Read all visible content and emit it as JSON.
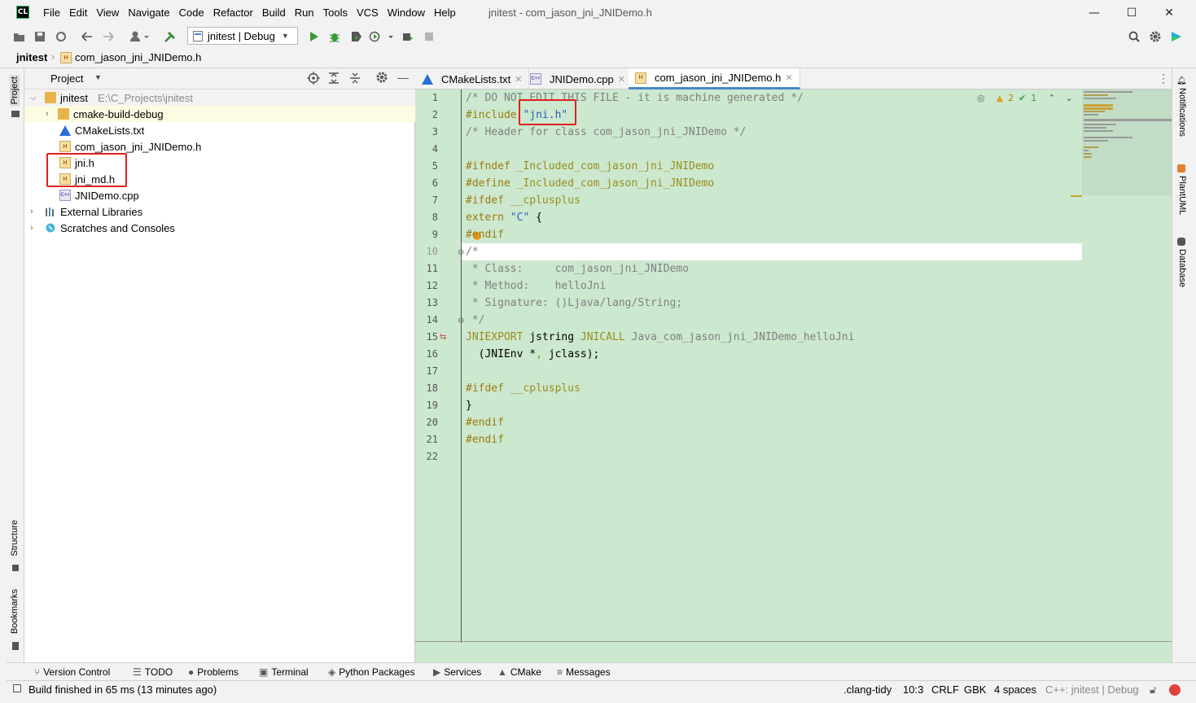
{
  "titlebar": {
    "logo": "CL",
    "menu": [
      "File",
      "Edit",
      "View",
      "Navigate",
      "Code",
      "Refactor",
      "Build",
      "Run",
      "Tools",
      "VCS",
      "Window",
      "Help"
    ],
    "window_title": "jnitest - com_jason_jni_JNIDemo.h",
    "minimize": "—",
    "maximize": "☐",
    "close": "✕"
  },
  "toolbar": {
    "run_config": "jnitest | Debug"
  },
  "navbar": {
    "root": "jnitest",
    "file": "com_jason_jni_JNIDemo.h"
  },
  "left_strip": {
    "project": "Project",
    "structure": "Structure",
    "bookmarks": "Bookmarks"
  },
  "project_panel": {
    "title": "Project",
    "tree": [
      {
        "label": "jnitest",
        "path": "E:\\C_Projects\\jnitest"
      },
      {
        "label": "cmake-build-debug"
      },
      {
        "label": "CMakeLists.txt"
      },
      {
        "label": "com_jason_jni_JNIDemo.h"
      },
      {
        "label": "jni.h"
      },
      {
        "label": "jni_md.h"
      },
      {
        "label": "JNIDemo.cpp"
      },
      {
        "label": "External Libraries"
      },
      {
        "label": "Scratches and Consoles"
      }
    ]
  },
  "editor": {
    "tabs": [
      {
        "label": "CMakeLists.txt"
      },
      {
        "label": "JNIDemo.cpp"
      },
      {
        "label": "com_jason_jni_JNIDemo.h"
      }
    ],
    "inspections": {
      "warnings": "2",
      "ok": "1"
    },
    "line_numbers": [
      "1",
      "2",
      "3",
      "4",
      "5",
      "6",
      "7",
      "8",
      "9",
      "10",
      "11",
      "12",
      "13",
      "14",
      "15",
      "16",
      "17",
      "18",
      "19",
      "20",
      "21",
      "22"
    ],
    "lines": {
      "l1": "/* DO NOT EDIT THIS FILE - it is machine generated */",
      "l2a": "#include ",
      "l2b": "\"jni.h\"",
      "l3": "/* Header for class com_jason_jni_JNIDemo */",
      "l5a": "#ifndef ",
      "l5b": "_Included_com_jason_jni_JNIDemo",
      "l6a": "#define ",
      "l6b": "_Included_com_jason_jni_JNIDemo",
      "l7a": "#ifdef ",
      "l7b": "__cplusplus",
      "l8a": "extern ",
      "l8b": "\"C\"",
      "l8c": " {",
      "l9": "#endif",
      "l10": "/*",
      "l11": " * Class:     com_jason_jni_JNIDemo",
      "l12": " * Method:    helloJni",
      "l13": " * Signature: ()Ljava/lang/String;",
      "l14": " */",
      "l15a": "JNIEXPORT ",
      "l15b": "jstring ",
      "l15c": "JNICALL ",
      "l15d": "Java_com_jason_jni_JNIDemo_helloJni",
      "l16a": "  (JNIEnv *",
      "l16b": ", ",
      "l16c": "jclass);",
      "l18a": "#ifdef ",
      "l18b": "__cplusplus",
      "l19": "}",
      "l20": "#endif",
      "l21": "#endif"
    }
  },
  "right_strip": {
    "notifications": "Notifications",
    "plantuml": "PlantUML",
    "database": "Database"
  },
  "bottom_tools": [
    "Version Control",
    "TODO",
    "Problems",
    "Terminal",
    "Python Packages",
    "Services",
    "CMake",
    "Messages"
  ],
  "status": {
    "message": "Build finished in 65 ms (13 minutes ago)",
    "clang_tidy": ".clang-tidy",
    "position": "10:3",
    "line_sep": "CRLF",
    "encoding": "GBK",
    "indent": "4 spaces",
    "context": "C++: jnitest | Debug"
  },
  "colors": {
    "editor_bg": "#cce8cf",
    "highlight_box": "#e02020",
    "accent": "#4a88c7"
  }
}
